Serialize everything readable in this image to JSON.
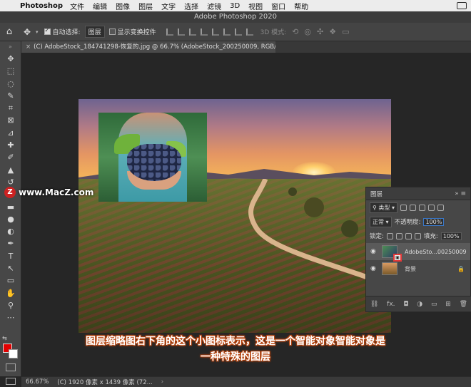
{
  "menubar": {
    "app_name": "Photoshop",
    "items": [
      "文件",
      "编辑",
      "图像",
      "图层",
      "文字",
      "选择",
      "滤镜",
      "3D",
      "视图",
      "窗口",
      "帮助"
    ]
  },
  "window": {
    "title": "Adobe Photoshop 2020"
  },
  "options_bar": {
    "auto_select_label": "自动选择:",
    "auto_select_target": "图层",
    "show_transform_label": "显示变换控件",
    "mode_3d_label": "3D 模式:"
  },
  "document_tab": {
    "label": "(C) AdobeStock_184741298-恢复的.jpg @ 66.7% (AdobeStock_200250009, RGB/8) *"
  },
  "watermark": {
    "text": "www.MacZ.com"
  },
  "layers_panel": {
    "title": "图层",
    "filter_kind": "类型",
    "blend_mode": "正常",
    "opacity_label": "不透明度:",
    "opacity_value": "100%",
    "lock_label": "锁定:",
    "fill_label": "填充:",
    "fill_value": "100%",
    "layers": [
      {
        "name": "AdobeSto...00250009",
        "type": "smart-object",
        "selected": true
      },
      {
        "name": "背景",
        "type": "background",
        "locked": true
      }
    ],
    "footer_fx_label": "fx."
  },
  "caption": {
    "line1": "图层缩略图右下角的这个小图标表示，这是一个智能对象智能对象是",
    "line2": "一种特殊的图层"
  },
  "status_bar": {
    "zoom": "66.67%",
    "doc_info": "(C) 1920 像素 x 1439 像素 (72..."
  },
  "colors": {
    "foreground": "#e00000",
    "background": "#ffffff",
    "highlight_box": "#e43a3a"
  }
}
